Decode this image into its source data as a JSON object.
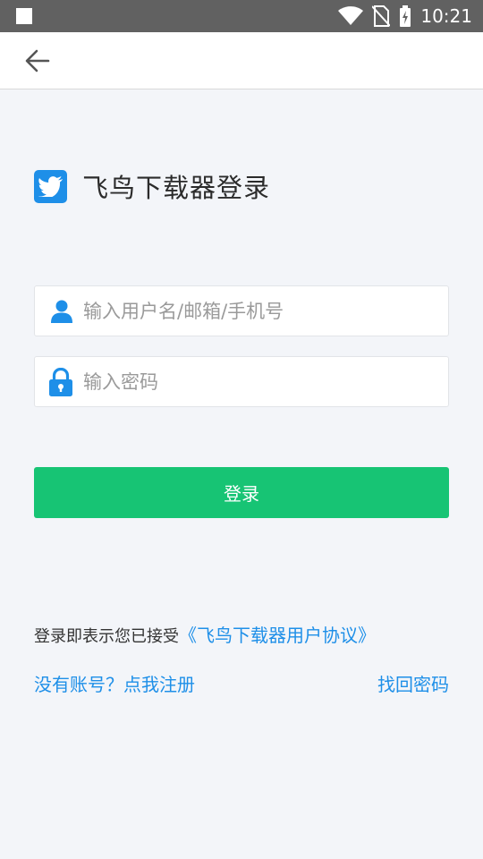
{
  "status_bar": {
    "time": "10:21",
    "icons": [
      "notification-square-icon",
      "wifi-icon",
      "no-sim-icon",
      "battery-charging-icon"
    ]
  },
  "app_bar": {
    "back_icon": "arrow-left-icon"
  },
  "brand": {
    "logo_icon": "bird-icon",
    "title": "飞鸟下载器登录"
  },
  "form": {
    "username_placeholder": "输入用户名/邮箱/手机号",
    "username_value": "",
    "username_icon": "user-icon",
    "password_placeholder": "输入密码",
    "password_value": "",
    "password_icon": "lock-icon",
    "login_label": "登录"
  },
  "footer": {
    "agreement_prefix": "登录即表示您已接受",
    "agreement_link": "《飞鸟下载器用户协议》",
    "register_label": "没有账号？点我注册",
    "forgot_label": "找回密码"
  },
  "colors": {
    "accent_blue": "#1e8fe8",
    "login_green": "#17c474",
    "background": "#f3f5f9",
    "status_bar": "#616161"
  }
}
